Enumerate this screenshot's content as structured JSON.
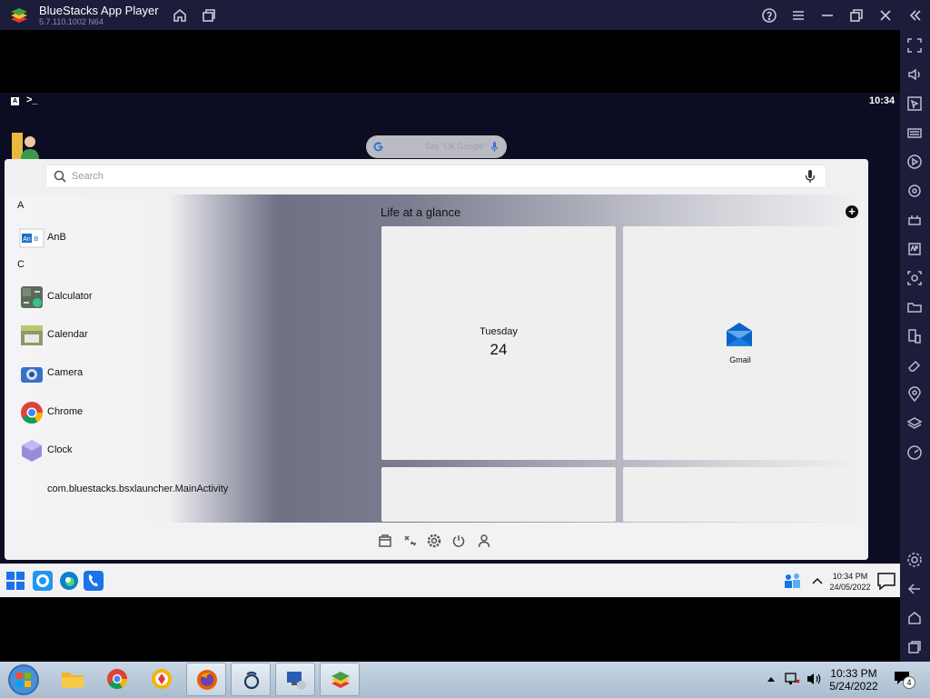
{
  "app": {
    "title": "BlueStacks App Player",
    "version": "5.7.110.1002 N64"
  },
  "android": {
    "status_time": "10:34",
    "status_a": "A",
    "status_term": ">_",
    "google_hint": "Say \"Ok Google\""
  },
  "drawer": {
    "search_placeholder": "Search",
    "sections": [
      {
        "letter": "A",
        "apps": [
          {
            "label": "AnB",
            "icon": "anb-icon"
          }
        ]
      },
      {
        "letter": "C",
        "apps": [
          {
            "label": "Calculator",
            "icon": "calculator-icon"
          },
          {
            "label": "Calendar",
            "icon": "calendar-icon"
          },
          {
            "label": "Camera",
            "icon": "camera-icon"
          },
          {
            "label": "Chrome",
            "icon": "chrome-icon"
          },
          {
            "label": "Clock",
            "icon": "clock-icon"
          },
          {
            "label": "com.bluestacks.bsxlauncher.MainActivity",
            "icon": "blank-icon"
          }
        ]
      }
    ],
    "glance_title": "Life at a glance",
    "tile_day": "Tuesday",
    "tile_date": "24",
    "tile_mail_label": "Gmail"
  },
  "win_taskbar": {
    "time": "10:34 PM",
    "date": "24/05/2022"
  },
  "host_taskbar": {
    "time": "10:33 PM",
    "date": "5/24/2022",
    "notification_count": "4"
  },
  "colors": {
    "titlebar": "#1b1d3a",
    "android_bg": "#0c0d22",
    "accent": "#1a73e8"
  }
}
